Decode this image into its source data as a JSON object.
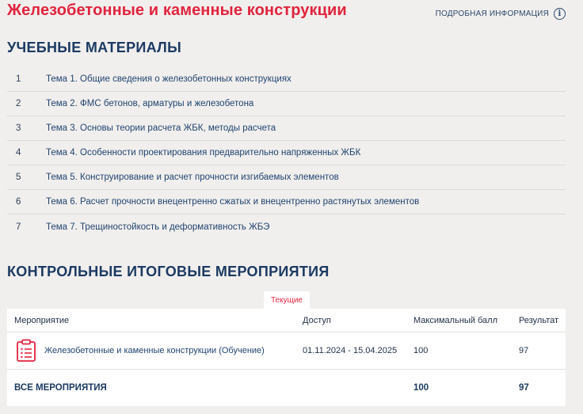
{
  "header": {
    "title": "Железобетонные и каменные конструкции",
    "info_label": "ПОДРОБНАЯ ИНФОРМАЦИЯ",
    "info_glyph": "i"
  },
  "materials": {
    "title": "УЧЕБНЫЕ МАТЕРИАЛЫ",
    "items": [
      {
        "num": "1",
        "label": "Тема 1. Общие сведения о железобетонных конструкциях"
      },
      {
        "num": "2",
        "label": "Тема 2. ФМС бетонов, арматуры и железобетона"
      },
      {
        "num": "3",
        "label": "Тема 3. Основы теории расчета ЖБК, методы расчета"
      },
      {
        "num": "4",
        "label": "Тема 4. Особенности проектирования предварительно напряженных ЖБК"
      },
      {
        "num": "5",
        "label": "Тема 5. Конструирование и расчет прочности изгибаемых элементов"
      },
      {
        "num": "6",
        "label": "Тема 6. Расчет прочности внецентренно сжатых и внецентренно растянутых элементов"
      },
      {
        "num": "7",
        "label": "Тема 7. Трещиностойкость и деформативность ЖБЭ"
      }
    ]
  },
  "events": {
    "title": "КОНТРОЛЬНЫЕ ИТОГОВЫЕ МЕРОПРИЯТИЯ",
    "tab_label": "Текущие",
    "columns": [
      "Мероприятие",
      "Доступ",
      "Максимальный балл",
      "Результат"
    ],
    "rows": [
      {
        "name": "Железобетонные и каменные конструкции (Обучение)",
        "access": "01.11.2024 - 15.04.2025",
        "max_score": "100",
        "result": "97",
        "icon": "clipboard-list-icon"
      }
    ],
    "total": {
      "label": "ВСЕ МЕРОПРИЯТИЯ",
      "max_score": "100",
      "result": "97"
    }
  },
  "colors": {
    "accent": "#e0243e",
    "heading": "#1b3a63",
    "background": "#f1efed"
  }
}
